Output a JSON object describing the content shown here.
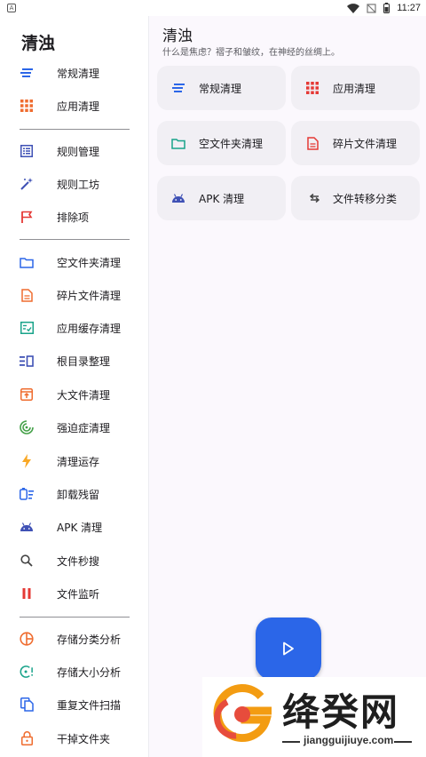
{
  "status_bar": {
    "time": "11:27"
  },
  "drawer": {
    "title": "清浊",
    "groups": [
      [
        {
          "label": "常规清理",
          "icon": "sort-lines-icon"
        },
        {
          "label": "应用清理",
          "icon": "apps-grid-icon"
        }
      ],
      [
        {
          "label": "规则管理",
          "icon": "list-box-icon"
        },
        {
          "label": "规则工坊",
          "icon": "magic-wand-icon"
        },
        {
          "label": "排除项",
          "icon": "flag-icon"
        }
      ],
      [
        {
          "label": "空文件夹清理",
          "icon": "folder-icon"
        },
        {
          "label": "碎片文件清理",
          "icon": "document-icon"
        },
        {
          "label": "应用缓存清理",
          "icon": "checklist-icon"
        },
        {
          "label": "根目录整理",
          "icon": "columns-icon"
        },
        {
          "label": "大文件清理",
          "icon": "archive-icon"
        },
        {
          "label": "强迫症清理",
          "icon": "target-icon"
        },
        {
          "label": "清理运存",
          "icon": "lightning-icon"
        },
        {
          "label": "卸载残留",
          "icon": "uninstall-icon"
        },
        {
          "label": "APK 清理",
          "icon": "android-icon"
        },
        {
          "label": "文件秒搜",
          "icon": "search-icon"
        },
        {
          "label": "文件监听",
          "icon": "pause-icon"
        }
      ],
      [
        {
          "label": "存储分类分析",
          "icon": "pie-chart-icon"
        },
        {
          "label": "存储大小分析",
          "icon": "radar-icon"
        },
        {
          "label": "重复文件扫描",
          "icon": "copy-icon"
        },
        {
          "label": "干掉文件夹",
          "icon": "lock-icon"
        }
      ]
    ]
  },
  "main": {
    "title": "清浊",
    "subtitle": "什么是焦虑？褶子和皱纹，在神经的丝绸上。",
    "cards": [
      {
        "label": "常规清理",
        "icon": "sort-lines-icon"
      },
      {
        "label": "应用清理",
        "icon": "apps-grid-icon"
      },
      {
        "label": "空文件夹清理",
        "icon": "folder-icon"
      },
      {
        "label": "碎片文件清理",
        "icon": "document-icon"
      },
      {
        "label": "APK 清理",
        "icon": "android-icon"
      },
      {
        "label": "文件转移分类",
        "icon": "transfer-icon"
      }
    ],
    "fab_icon": "play-icon"
  },
  "watermark": {
    "brand": "绛癸网",
    "url": "jiangguijiuye.com"
  },
  "colors": {
    "primary": "#2b66e8",
    "card_bg": "#f1eff4",
    "orange": "#ef6c2f",
    "red": "#e53935",
    "teal": "#19a38a",
    "indigo": "#3f51b5",
    "green": "#43a047",
    "amber": "#f9a825"
  }
}
